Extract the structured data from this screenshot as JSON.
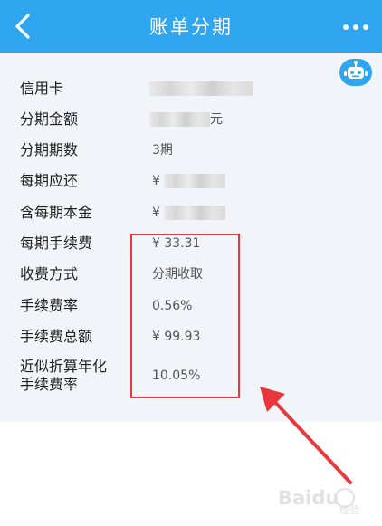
{
  "header": {
    "title": "账单分期"
  },
  "details": [
    {
      "label": "信用卡",
      "value": ""
    },
    {
      "label": "分期金额",
      "value": "元"
    },
    {
      "label": "分期期数",
      "value": "3期"
    },
    {
      "label": "每期应还",
      "value": "¥"
    },
    {
      "label": "含每期本金",
      "value": "¥"
    },
    {
      "label": "每期手续费",
      "value": "¥ 33.31"
    },
    {
      "label": "收费方式",
      "value": "分期收取"
    },
    {
      "label": "手续费率",
      "value": "0.56%"
    },
    {
      "label": "手续费总额",
      "value": "¥ 99.93"
    },
    {
      "label": "近似折算年化",
      "value": "10.05%"
    },
    {
      "label": "手续费率",
      "value": ""
    }
  ],
  "watermark": {
    "brand": "Baidu",
    "suffix": "经验"
  },
  "colors": {
    "navbar": "#2fa6ef",
    "content_bg": "#f1f4f8",
    "highlight": "#e8383d"
  },
  "icons": {
    "back": "chevron-left-icon",
    "more": "more-dots-icon",
    "assistant": "robot-icon"
  }
}
